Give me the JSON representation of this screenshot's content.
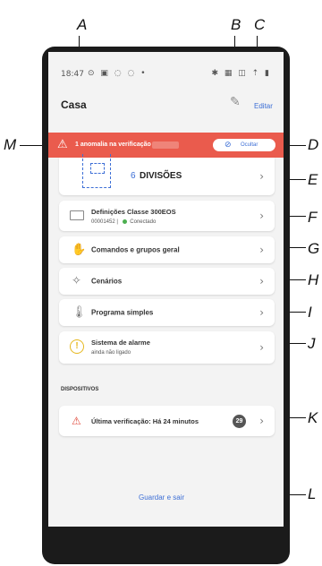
{
  "callouts": {
    "A": "A",
    "B": "B",
    "C": "C",
    "D": "D",
    "E": "E",
    "F": "F",
    "G": "G",
    "H": "H",
    "I": "I",
    "J": "J",
    "K": "K",
    "L": "L",
    "M": "M"
  },
  "status_bar": {
    "time": "18:47",
    "icons_left": "⊙ ▣ ◌ ◌ •",
    "icons_right": "✱ ▦ ◫ ⇡ ▮"
  },
  "header": {
    "title": "Casa",
    "edit_label": "Editar"
  },
  "alert": {
    "text": "1 anomalia na verificação",
    "hide_label": "Ocultar"
  },
  "divisions": {
    "count": "6",
    "label": "DIVISÕES"
  },
  "device": {
    "title": "Definições Classe 300EOS",
    "id": "00001452",
    "separator": "|",
    "status": "Conectado"
  },
  "menu": {
    "items": [
      {
        "label": "Comandos e grupos geral",
        "icon": "hand-icon"
      },
      {
        "label": "Cenários",
        "icon": "wand-icon"
      },
      {
        "label": "Programa simples",
        "icon": "thermometer-icon"
      }
    ]
  },
  "alarm": {
    "title": "Sistema de alarme",
    "subtitle": "ainda não ligado"
  },
  "devices_section": {
    "title": "DISPOSITIVOS"
  },
  "last_check": {
    "text": "Última verificação: Há 24 minutos",
    "badge": "29"
  },
  "save": {
    "label": "Guardar e sair"
  },
  "colors": {
    "accent": "#3d6fd6",
    "alert": "#ea5b4d",
    "ok": "#4caf50",
    "warning": "#e6b820"
  }
}
